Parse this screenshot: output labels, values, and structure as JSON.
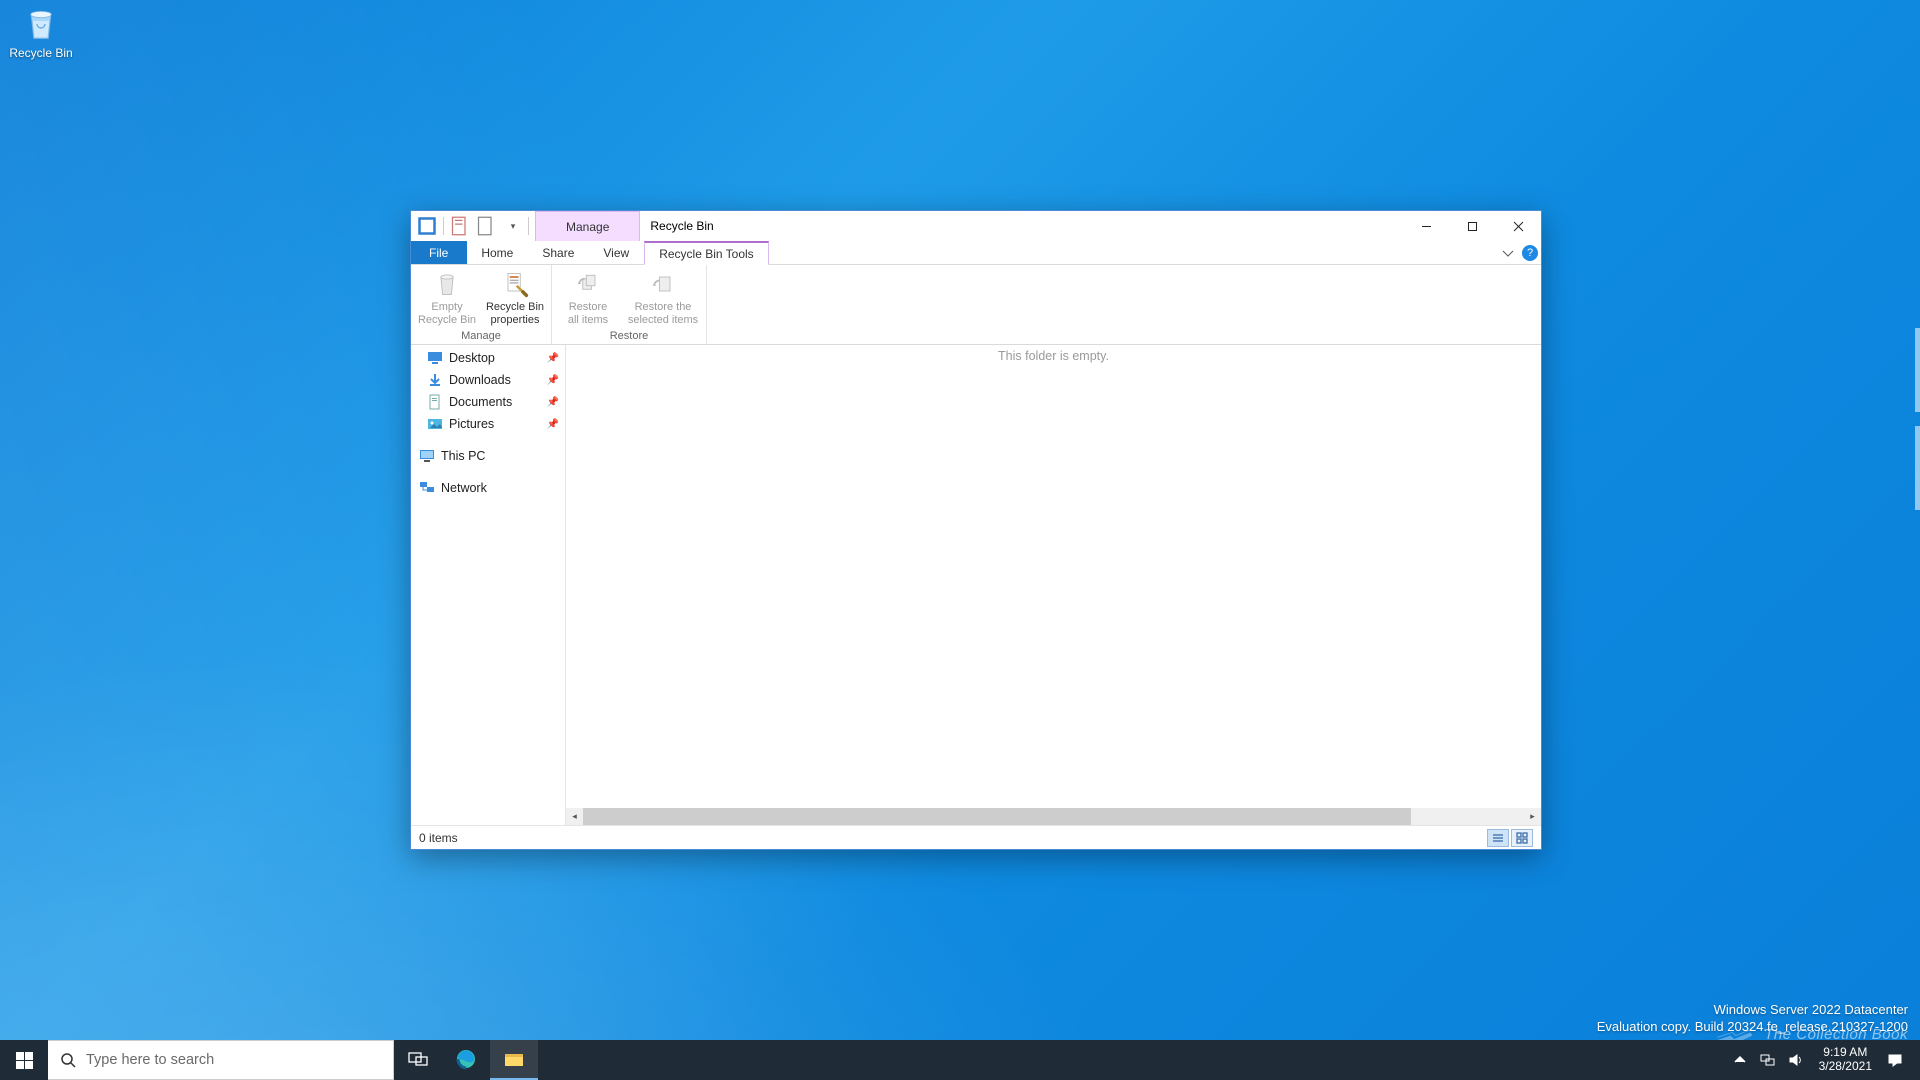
{
  "desktop": {
    "recycle_bin_label": "Recycle Bin"
  },
  "watermark": {
    "line1": "Windows Server 2022 Datacenter",
    "line2": "Evaluation copy. Build 20324.fe_release.210327-1200"
  },
  "collection_mark": "The Collection Book",
  "taskbar": {
    "search_placeholder": "Type here to search",
    "clock_time": "9:19 AM",
    "clock_date": "3/28/2021"
  },
  "explorer": {
    "context_tab": "Manage",
    "title": "Recycle Bin",
    "tabs": {
      "file": "File",
      "home": "Home",
      "share": "Share",
      "view": "View",
      "tools": "Recycle Bin Tools"
    },
    "ribbon": {
      "empty_l1": "Empty",
      "empty_l2": "Recycle Bin",
      "props_l1": "Recycle Bin",
      "props_l2": "properties",
      "restore_all_l1": "Restore",
      "restore_all_l2": "all items",
      "restore_sel_l1": "Restore the",
      "restore_sel_l2": "selected items",
      "group_manage": "Manage",
      "group_restore": "Restore"
    },
    "nav": {
      "desktop": "Desktop",
      "downloads": "Downloads",
      "documents": "Documents",
      "pictures": "Pictures",
      "this_pc": "This PC",
      "network": "Network"
    },
    "empty_message": "This folder is empty.",
    "status_items": "0 items"
  }
}
